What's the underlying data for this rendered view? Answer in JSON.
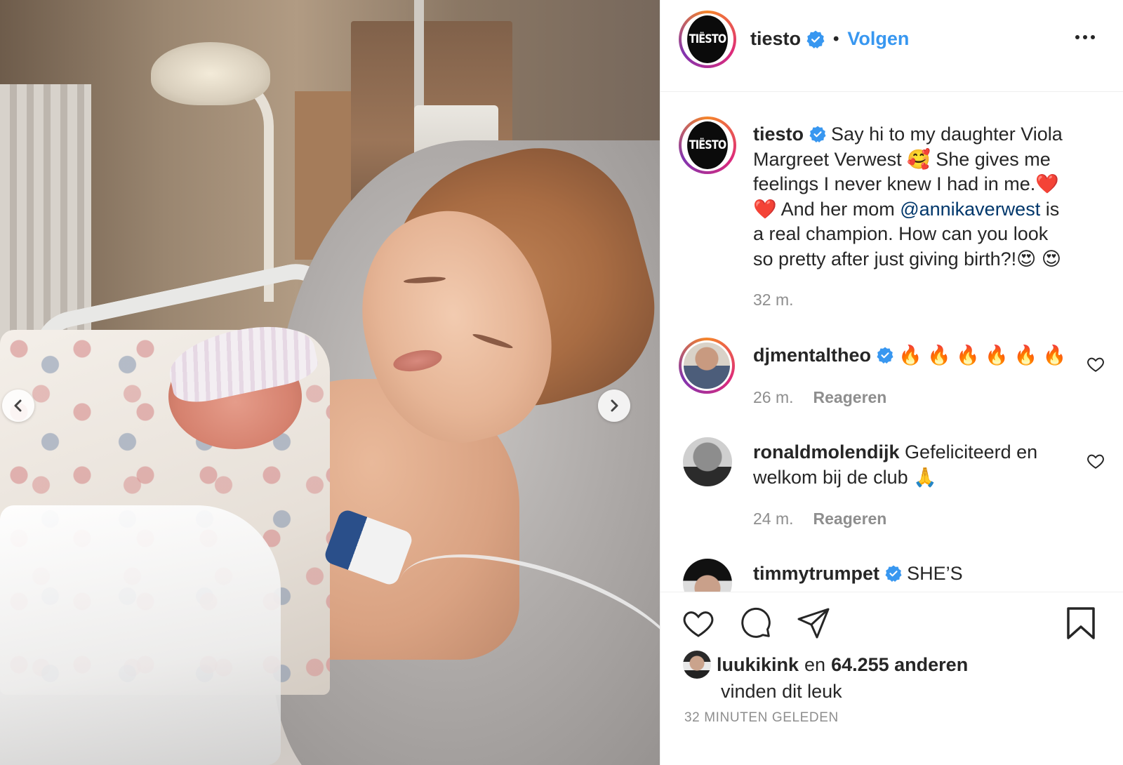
{
  "post": {
    "username": "tiesto",
    "avatar_text": "TIËSTO",
    "follow_label": "Volgen",
    "separator": "•"
  },
  "caption": {
    "username": "tiesto",
    "text_part1": "Say hi to my daughter Viola Margreet Verwest 🥰  She gives me feelings I never knew I had in me.❤️ ❤️ And her mom ",
    "mention": "@annikaverwest",
    "text_part2": " is a real champion. How can you look so pretty after just giving birth?!😍 😍",
    "time": "32 m."
  },
  "comments": [
    {
      "username": "djmentaltheo",
      "verified": true,
      "text": "🔥 🔥 🔥 🔥 🔥 🔥",
      "time": "26 m.",
      "reply_label": "Reageren"
    },
    {
      "username": "ronaldmolendijk",
      "verified": false,
      "text": "Gefeliciteerd en welkom bij de club 🙏",
      "time": "24 m.",
      "reply_label": "Reageren"
    },
    {
      "username": "timmytrumpet",
      "verified": true,
      "text": "SHE’S",
      "time": "",
      "reply_label": ""
    }
  ],
  "likes": {
    "first_liker": "luukikink",
    "connector": "en",
    "others": "64.255 anderen",
    "suffix": "vinden dit leuk"
  },
  "timestamp": "32 MINUTEN GELEDEN",
  "colors": {
    "link": "#3897f0",
    "mention": "#00376b",
    "verified": "#3897f0",
    "muted": "#8e8e8e"
  },
  "icons": [
    "chevron-left-icon",
    "chevron-right-icon",
    "verified-icon",
    "more-icon",
    "heart-icon",
    "comment-icon",
    "share-icon",
    "bookmark-icon"
  ]
}
